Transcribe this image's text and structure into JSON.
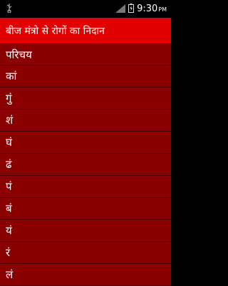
{
  "status_bar": {
    "time": "9:30",
    "ampm": "PM",
    "icons": [
      "usb-icon",
      "signal-icon",
      "battery-icon"
    ]
  },
  "header": {
    "title": "बीज मंत्रो से रोगों का निदान"
  },
  "list": {
    "items": [
      "परिचय",
      "कां",
      "गुं",
      "शं",
      "घं",
      "ढं",
      "पं",
      "बं",
      "यं",
      "रं",
      "लं"
    ]
  },
  "colors": {
    "header_bg": "#e00000",
    "list_bg": "#8a0000",
    "divider": "#4a0000"
  }
}
